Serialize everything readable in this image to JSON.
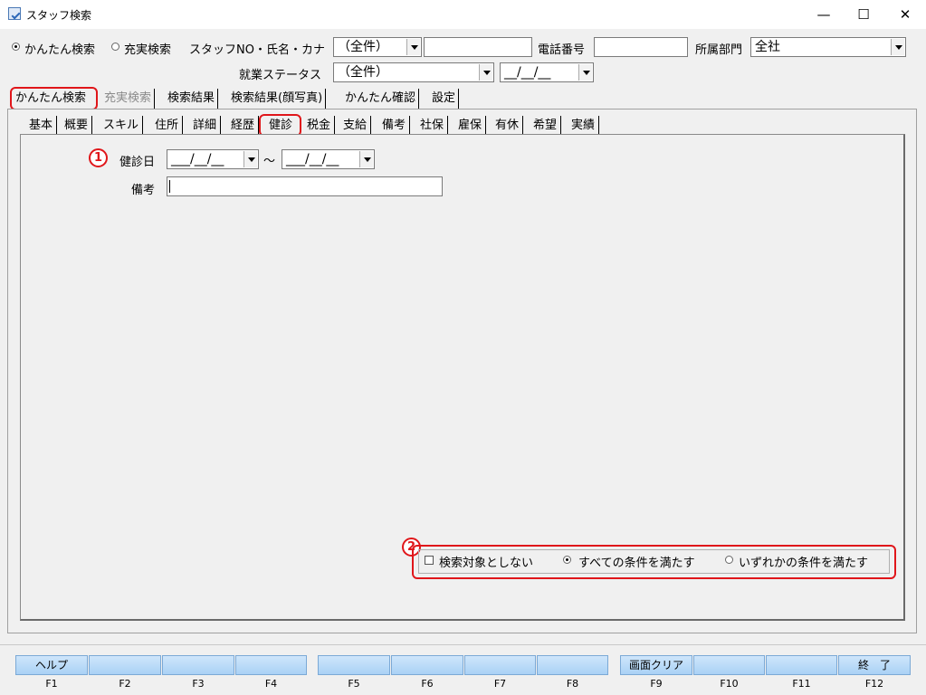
{
  "window": {
    "title": "スタッフ検索",
    "min": "—",
    "max": "☐",
    "close": "✕"
  },
  "search": {
    "mode_simple": "かんたん検索",
    "mode_full": "充実検索",
    "staff_label": "スタッフNO・氏名・カナ",
    "staff_scope": "（全件）",
    "staff_value": "",
    "phone_label": "電話番号",
    "phone_value": "",
    "dept_label": "所属部門",
    "dept_value": "全社",
    "status_label": "就業ステータス",
    "status_value": "（全件）",
    "date_value": "__/__/__"
  },
  "tabs": [
    "かんたん検索",
    "充実検索",
    "検索結果",
    "検索結果(顔写真)",
    "かんたん確認",
    "設定"
  ],
  "subtabs": [
    "基本",
    "概要",
    "スキル",
    "住所",
    "詳細",
    "経歴",
    "健診",
    "税金",
    "支給",
    "備考",
    "社保",
    "雇保",
    "有休",
    "希望",
    "実績"
  ],
  "checkup": {
    "marker1": "1",
    "date_label": "健診日",
    "date_from": "___/__/__",
    "date_to": "___/__/__",
    "tilde": "～",
    "note_label": "備考",
    "note_value": ""
  },
  "conditions": {
    "marker2": "2",
    "exclude": "検索対象としない",
    "all": "すべての条件を満たす",
    "any": "いずれかの条件を満たす"
  },
  "fkeys": {
    "labels": [
      "ヘルプ",
      "",
      "",
      "",
      "",
      "",
      "",
      "",
      "画面クリア",
      "",
      "",
      "終　了"
    ],
    "keys": [
      "F1",
      "F2",
      "F3",
      "F4",
      "F5",
      "F6",
      "F7",
      "F8",
      "F9",
      "F10",
      "F11",
      "F12"
    ]
  },
  "colors": {
    "highlight": "#e0161a",
    "fkey": "#b9dcf8"
  }
}
